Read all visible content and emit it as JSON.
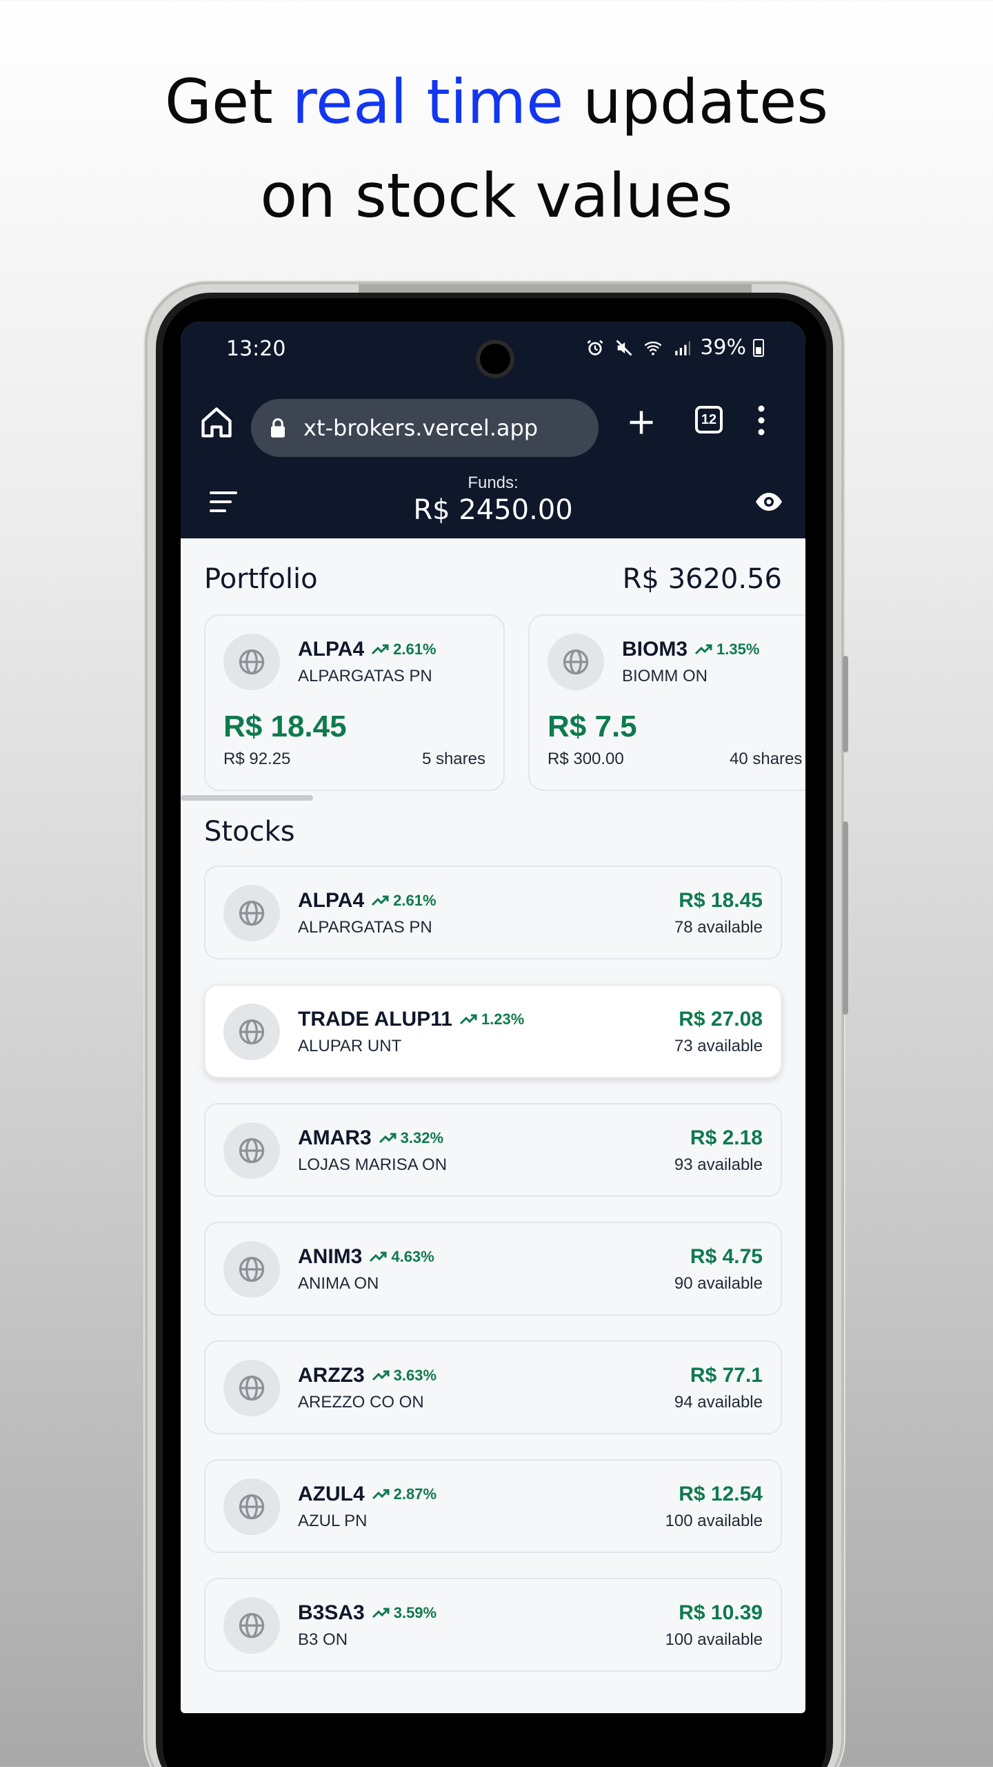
{
  "headline": {
    "part1": "Get ",
    "accent": "real time",
    "part2": " updates",
    "line2": "on stock values",
    "accent_color": "#1336f0"
  },
  "status_bar": {
    "time": "13:20",
    "battery": "39%",
    "icons": [
      "alarm-icon",
      "mute-icon",
      "wifi-icon",
      "signal-icon",
      "battery-icon"
    ]
  },
  "browser": {
    "url": "xt-brokers.vercel.app",
    "tab_count": "12"
  },
  "app_header": {
    "funds_label": "Funds:",
    "funds_value": "R$ 2450.00"
  },
  "portfolio": {
    "title": "Portfolio",
    "total": "R$ 3620.56",
    "cards": [
      {
        "ticker": "ALPA4",
        "change": "2.61%",
        "company": "ALPARGATAS PN",
        "price": "R$ 18.45",
        "position_value": "R$ 92.25",
        "shares": "5 shares"
      },
      {
        "ticker": "BIOM3",
        "change": "1.35%",
        "company": "BIOMM ON",
        "price": "R$ 7.5",
        "position_value": "R$ 300.00",
        "shares": "40 shares"
      }
    ]
  },
  "stocks": {
    "title": "Stocks",
    "rows": [
      {
        "ticker": "ALPA4",
        "change": "2.61%",
        "company": "ALPARGATAS PN",
        "price": "R$ 18.45",
        "available": "78 available"
      },
      {
        "ticker": "TRADE ALUP11",
        "change": "1.23%",
        "company": "ALUPAR UNT",
        "price": "R$ 27.08",
        "available": "73 available"
      },
      {
        "ticker": "AMAR3",
        "change": "3.32%",
        "company": "LOJAS MARISA ON",
        "price": "R$ 2.18",
        "available": "93 available"
      },
      {
        "ticker": "ANIM3",
        "change": "4.63%",
        "company": "ANIMA ON",
        "price": "R$ 4.75",
        "available": "90 available"
      },
      {
        "ticker": "ARZZ3",
        "change": "3.63%",
        "company": "AREZZO CO ON",
        "price": "R$ 77.1",
        "available": "94 available"
      },
      {
        "ticker": "AZUL4",
        "change": "2.87%",
        "company": "AZUL PN",
        "price": "R$ 12.54",
        "available": "100 available"
      },
      {
        "ticker": "B3SA3",
        "change": "3.59%",
        "company": "B3 ON",
        "price": "R$ 10.39",
        "available": "100 available"
      }
    ]
  },
  "colors": {
    "header_bg": "#0f172a",
    "positive": "#0e7a4d"
  }
}
